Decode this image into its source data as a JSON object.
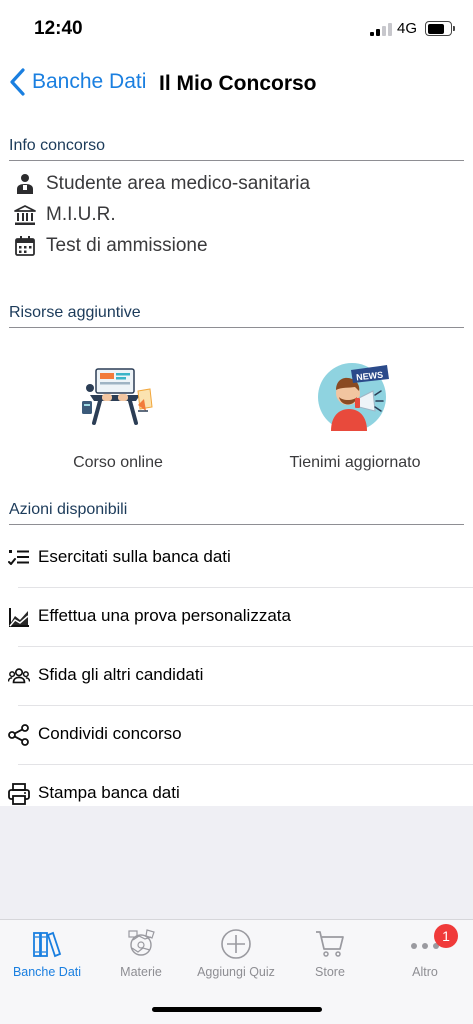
{
  "status_bar": {
    "time": "12:40",
    "network": "4G",
    "battery_level": 0.76,
    "signal_bars_active": 2
  },
  "nav": {
    "back_label": "Banche Dati",
    "title": "Il Mio Concorso"
  },
  "info": {
    "header": "Info concorso",
    "items": [
      {
        "icon": "person-icon",
        "text": "Studente area medico-sanitaria"
      },
      {
        "icon": "institution-icon",
        "text": "M.I.U.R."
      },
      {
        "icon": "calendar-icon",
        "text": "Test di ammissione"
      }
    ]
  },
  "resources": {
    "header": "Risorse aggiuntive",
    "items": [
      {
        "icon": "online-course-illustration",
        "label": "Corso online"
      },
      {
        "icon": "news-megaphone-illustration",
        "label": "Tienimi aggiornato",
        "news_text": "NEWS"
      }
    ]
  },
  "actions": {
    "header": "Azioni disponibili",
    "items": [
      {
        "icon": "checklist-icon",
        "label": "Esercitati sulla banca dati"
      },
      {
        "icon": "chart-icon",
        "label": "Effettua una prova personalizzata"
      },
      {
        "icon": "group-icon",
        "label": "Sfida gli altri candidati"
      },
      {
        "icon": "share-icon",
        "label": "Condividi concorso"
      },
      {
        "icon": "printer-icon",
        "label": "Stampa banca dati"
      }
    ]
  },
  "tab_bar": {
    "tabs": [
      {
        "icon": "books-icon",
        "label": "Banche Dati",
        "active": true
      },
      {
        "icon": "subjects-icon",
        "label": "Materie",
        "active": false
      },
      {
        "icon": "add-circle-icon",
        "label": "Aggiungi Quiz",
        "active": false
      },
      {
        "icon": "cart-icon",
        "label": "Store",
        "active": false
      },
      {
        "icon": "more-icon",
        "label": "Altro",
        "active": false,
        "badge": "1"
      }
    ]
  },
  "colors": {
    "accent": "#1a7fe0",
    "badge": "#f03a3a",
    "background_gray": "#efeff4",
    "section_text": "#1c3b5a"
  }
}
